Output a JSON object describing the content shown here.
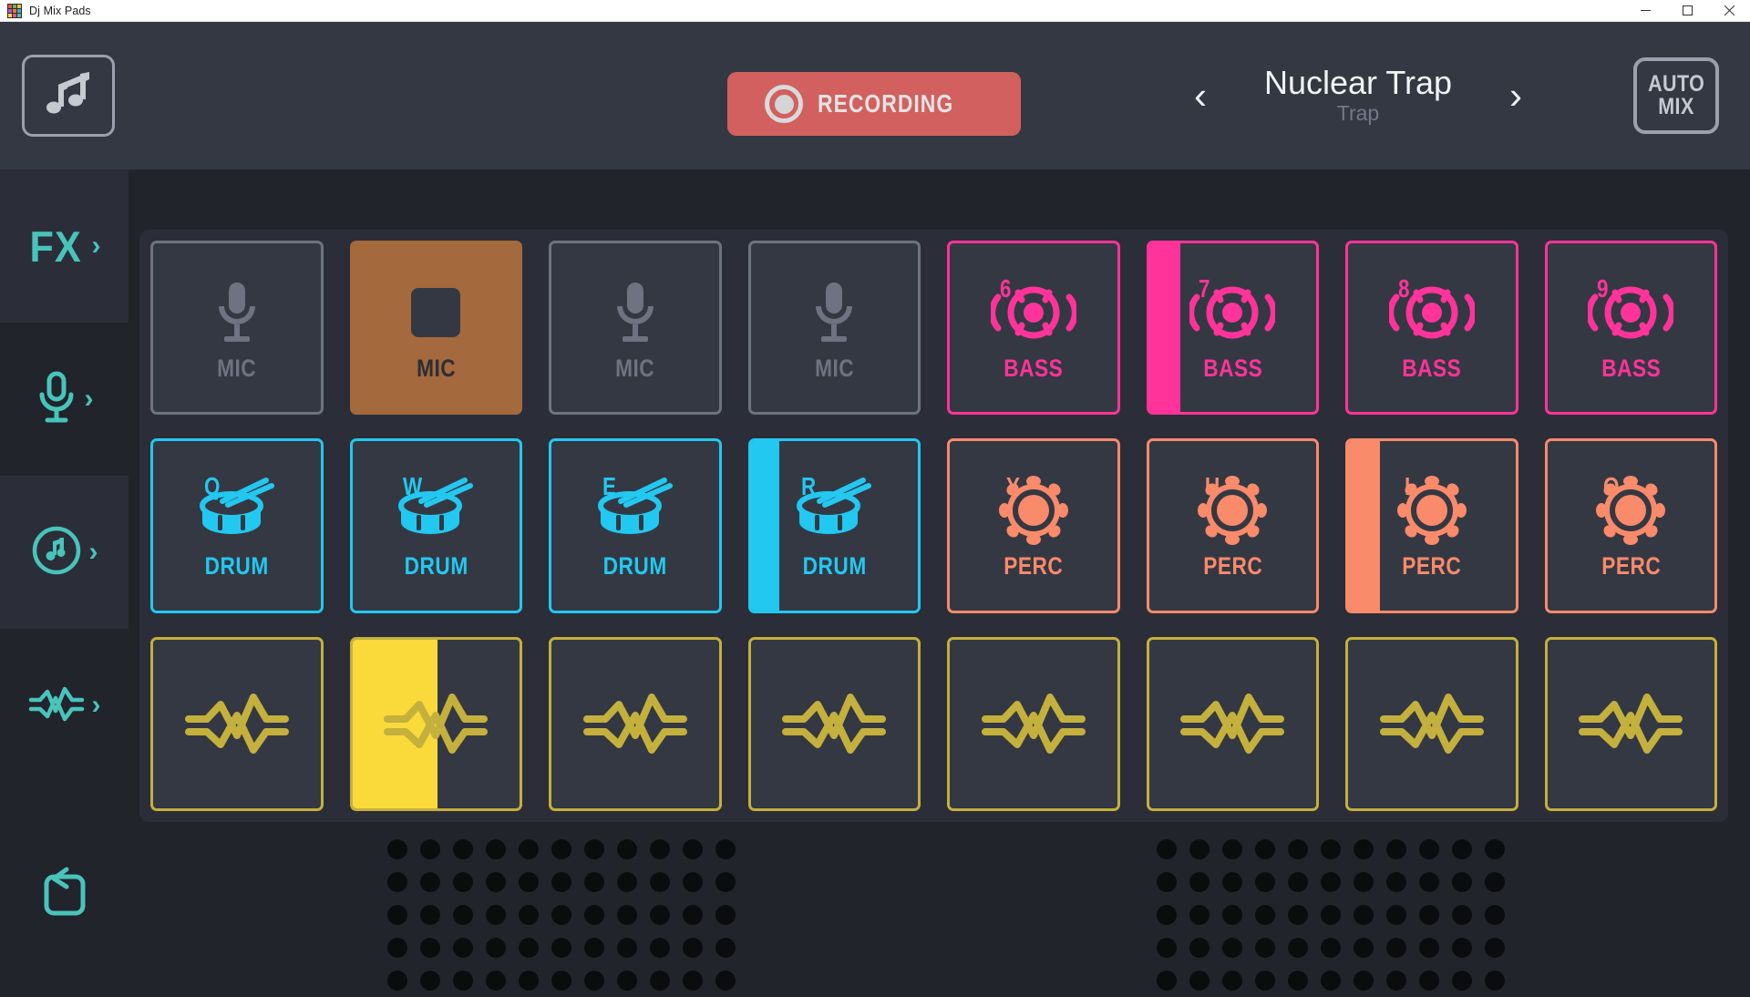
{
  "window": {
    "title": "Dj Mix Pads",
    "icon": "app-grid-icon",
    "controls": {
      "minimize": "minimize",
      "maximize": "maximize",
      "close": "close"
    }
  },
  "header": {
    "logo_icon": "music-notes-icon",
    "record_button": {
      "label": "RECORDING",
      "icon": "record-dot-icon",
      "color": "#d2605e",
      "active": true
    },
    "track": {
      "title": "Nuclear Trap",
      "genre": "Trap",
      "prev_icon": "chevron-left-icon",
      "next_icon": "chevron-right-icon"
    },
    "auto_mix": {
      "line1": "AUTO",
      "line2": "MIX"
    }
  },
  "sidebar": {
    "accent": "#48c4bb",
    "items": [
      {
        "label": "FX",
        "icon": "fx-text-icon",
        "chevron": "chevron-right-icon",
        "shaded": true
      },
      {
        "label": "",
        "icon": "microphone-icon",
        "chevron": "chevron-right-icon",
        "shaded": false
      },
      {
        "label": "",
        "icon": "music-circle-icon",
        "chevron": "chevron-right-icon",
        "shaded": true
      },
      {
        "label": "",
        "icon": "waveform-icon",
        "chevron": "chevron-right-icon",
        "shaded": false
      },
      {
        "label": "",
        "icon": "loop-icon",
        "chevron": "",
        "shaded": false
      }
    ]
  },
  "pads": {
    "colors": {
      "mic": "#6d7380",
      "mic_active_bg": "#a4693c",
      "bass": "#ff3399",
      "drum": "#22c8f0",
      "perc": "#f98a6a",
      "fx": "#c4b03c",
      "fx_active": "#fada3a",
      "pad_bg": "#343843"
    },
    "rows": [
      [
        {
          "hotkey": "",
          "label": "MIC",
          "icon": "microphone-icon",
          "color": "#6d7380",
          "state": "idle",
          "progress": 0
        },
        {
          "hotkey": "",
          "label": "MIC",
          "icon": "stop-square-icon",
          "color": "#a4693c",
          "state": "recording",
          "progress": 0
        },
        {
          "hotkey": "",
          "label": "MIC",
          "icon": "microphone-icon",
          "color": "#6d7380",
          "state": "idle",
          "progress": 0
        },
        {
          "hotkey": "",
          "label": "MIC",
          "icon": "microphone-icon",
          "color": "#6d7380",
          "state": "idle",
          "progress": 0
        },
        {
          "hotkey": "6",
          "label": "BASS",
          "icon": "speaker-icon",
          "color": "#ff3399",
          "state": "idle",
          "progress": 0
        },
        {
          "hotkey": "7",
          "label": "BASS",
          "icon": "speaker-icon",
          "color": "#ff3399",
          "state": "playing",
          "progress": 19
        },
        {
          "hotkey": "8",
          "label": "BASS",
          "icon": "speaker-icon",
          "color": "#ff3399",
          "state": "idle",
          "progress": 0
        },
        {
          "hotkey": "9",
          "label": "BASS",
          "icon": "speaker-icon",
          "color": "#ff3399",
          "state": "idle",
          "progress": 0
        }
      ],
      [
        {
          "hotkey": "Q",
          "label": "DRUM",
          "icon": "snare-drum-icon",
          "color": "#22c8f0",
          "state": "idle",
          "progress": 0
        },
        {
          "hotkey": "W",
          "label": "DRUM",
          "icon": "snare-drum-icon",
          "color": "#22c8f0",
          "state": "idle",
          "progress": 0
        },
        {
          "hotkey": "E",
          "label": "DRUM",
          "icon": "snare-drum-icon",
          "color": "#22c8f0",
          "state": "idle",
          "progress": 0
        },
        {
          "hotkey": "R",
          "label": "DRUM",
          "icon": "snare-drum-icon",
          "color": "#22c8f0",
          "state": "playing",
          "progress": 17
        },
        {
          "hotkey": "Y",
          "label": "PERC",
          "icon": "tambourine-icon",
          "color": "#f98a6a",
          "state": "idle",
          "progress": 0
        },
        {
          "hotkey": "U",
          "label": "PERC",
          "icon": "tambourine-icon",
          "color": "#f98a6a",
          "state": "idle",
          "progress": 0
        },
        {
          "hotkey": "I",
          "label": "PERC",
          "icon": "tambourine-icon",
          "color": "#f98a6a",
          "state": "playing",
          "progress": 19
        },
        {
          "hotkey": "O",
          "label": "PERC",
          "icon": "tambourine-icon",
          "color": "#f98a6a",
          "state": "idle",
          "progress": 0
        }
      ],
      [
        {
          "hotkey": "",
          "label": "",
          "icon": "double-waveform-icon",
          "color": "#c4b03c",
          "state": "idle",
          "progress": 0
        },
        {
          "hotkey": "",
          "label": "",
          "icon": "double-waveform-icon",
          "color": "#c4b03c",
          "state": "playing",
          "progress": 51
        },
        {
          "hotkey": "",
          "label": "",
          "icon": "double-waveform-icon",
          "color": "#c4b03c",
          "state": "idle",
          "progress": 0
        },
        {
          "hotkey": "",
          "label": "",
          "icon": "double-waveform-icon",
          "color": "#c4b03c",
          "state": "idle",
          "progress": 0
        },
        {
          "hotkey": "",
          "label": "",
          "icon": "double-waveform-icon",
          "color": "#c4b03c",
          "state": "idle",
          "progress": 0
        },
        {
          "hotkey": "",
          "label": "",
          "icon": "double-waveform-icon",
          "color": "#c4b03c",
          "state": "idle",
          "progress": 0
        },
        {
          "hotkey": "",
          "label": "",
          "icon": "double-waveform-icon",
          "color": "#c4b03c",
          "state": "idle",
          "progress": 0
        },
        {
          "hotkey": "",
          "label": "",
          "icon": "double-waveform-icon",
          "color": "#c4b03c",
          "state": "idle",
          "progress": 0
        }
      ]
    ]
  },
  "speakers": {
    "left": {
      "name": "left-speaker-grille",
      "cols": 11,
      "rows": 5
    },
    "right": {
      "name": "right-speaker-grille",
      "cols": 11,
      "rows": 5
    }
  }
}
